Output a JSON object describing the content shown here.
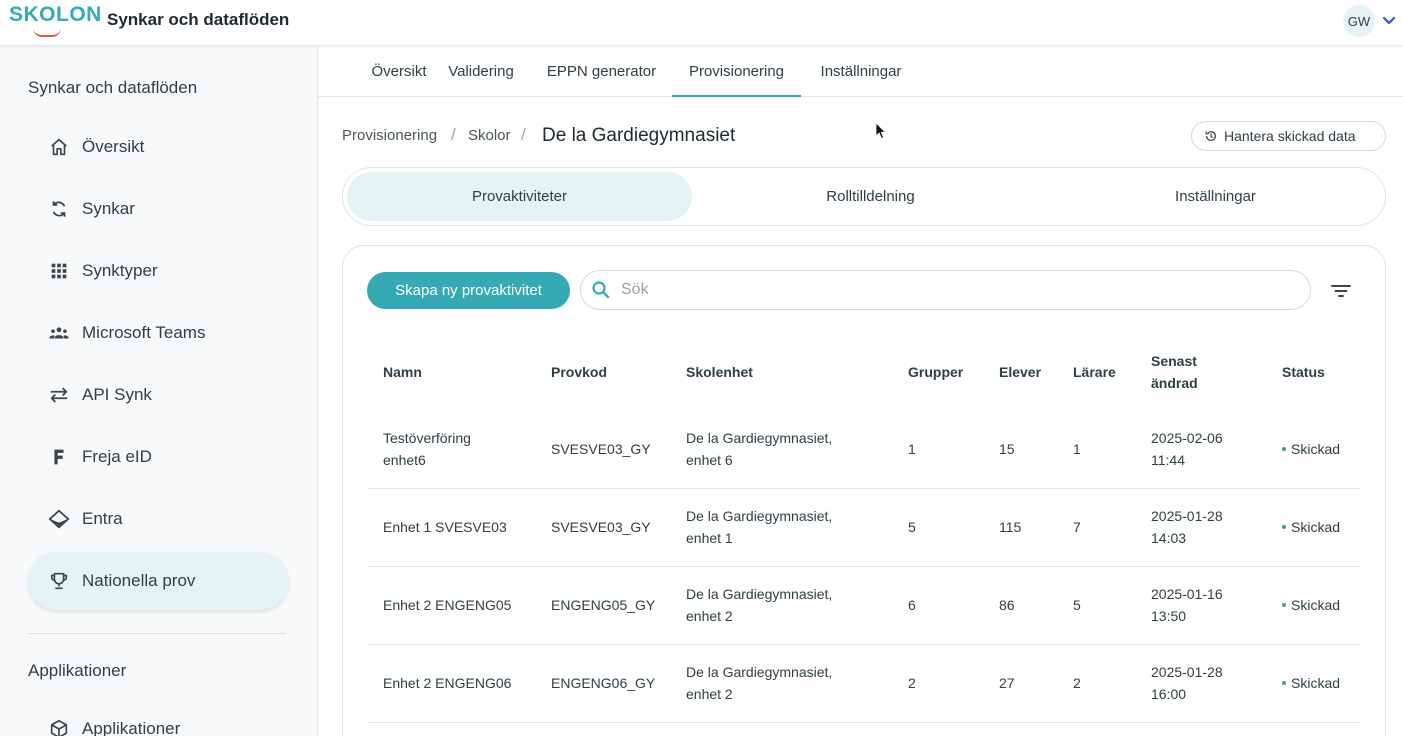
{
  "header": {
    "logo_text": "SKOLON",
    "app_title": "Synkar och dataflöden",
    "user_initials": "GW"
  },
  "sidebar": {
    "heading": "Synkar och dataflöden",
    "items": [
      {
        "label": "Översikt",
        "icon": "home-icon"
      },
      {
        "label": "Synkar",
        "icon": "sync-icon"
      },
      {
        "label": "Synktyper",
        "icon": "grid-icon"
      },
      {
        "label": "Microsoft Teams",
        "icon": "teams-icon"
      },
      {
        "label": "API Synk",
        "icon": "swap-arrows-icon"
      },
      {
        "label": "Freja eID",
        "icon": "freja-icon"
      },
      {
        "label": "Entra",
        "icon": "entra-icon"
      },
      {
        "label": "Nationella prov",
        "icon": "trophy-icon",
        "active": true
      }
    ],
    "section2_heading": "Applikationer",
    "section2_items": [
      {
        "label": "Applikationer",
        "icon": "cube-icon"
      }
    ]
  },
  "tabs": [
    {
      "label": "Översikt"
    },
    {
      "label": "Validering"
    },
    {
      "label": "EPPN generator"
    },
    {
      "label": "Provisionering",
      "active": true
    },
    {
      "label": "Inställningar"
    }
  ],
  "breadcrumb": {
    "items": [
      "Provisionering",
      "Skolor"
    ],
    "separator": "/",
    "current": "De la Gardiegymnasiet"
  },
  "manage_button": "Hantera skickad data",
  "segments": [
    {
      "label": "Provaktiviteter",
      "active": true
    },
    {
      "label": "Rolltilldelning"
    },
    {
      "label": "Inställningar"
    }
  ],
  "toolbar": {
    "create_label": "Skapa ny provaktivitet",
    "search_placeholder": "Sök"
  },
  "table": {
    "headers": {
      "name": "Namn",
      "code": "Provkod",
      "unit": "Skolenhet",
      "groups": "Grupper",
      "students": "Elever",
      "teachers": "Lärare",
      "changed_1": "Senast",
      "changed_2": "ändrad",
      "status": "Status"
    },
    "rows": [
      {
        "name_1": "Testöverföring",
        "name_2": "enhet6",
        "code": "SVESVE03_GY",
        "unit_1": "De la Gardiegymnasiet,",
        "unit_2": "enhet 6",
        "groups": "1",
        "students": "15",
        "teachers": "1",
        "date": "2025-02-06",
        "time": "11:44",
        "status": "Skickad"
      },
      {
        "name_1": "Enhet 1 SVESVE03",
        "name_2": "",
        "code": "SVESVE03_GY",
        "unit_1": "De la Gardiegymnasiet,",
        "unit_2": "enhet 1",
        "groups": "5",
        "students": "115",
        "teachers": "7",
        "date": "2025-01-28",
        "time": "14:03",
        "status": "Skickad"
      },
      {
        "name_1": "Enhet 2 ENGENG05",
        "name_2": "",
        "code": "ENGENG05_GY",
        "unit_1": "De la Gardiegymnasiet,",
        "unit_2": "enhet 2",
        "groups": "6",
        "students": "86",
        "teachers": "5",
        "date": "2025-01-16",
        "time": "13:50",
        "status": "Skickad"
      },
      {
        "name_1": "Enhet 2 ENGENG06",
        "name_2": "",
        "code": "ENGENG06_GY",
        "unit_1": "De la Gardiegymnasiet,",
        "unit_2": "enhet 2",
        "groups": "2",
        "students": "27",
        "teachers": "2",
        "date": "2025-01-28",
        "time": "16:00",
        "status": "Skickad"
      }
    ]
  },
  "colors": {
    "accent": "#35aab4",
    "active_bg": "#e6f3f4",
    "status_dot": "#3aa66b",
    "logo_smile": "#e8553f"
  }
}
